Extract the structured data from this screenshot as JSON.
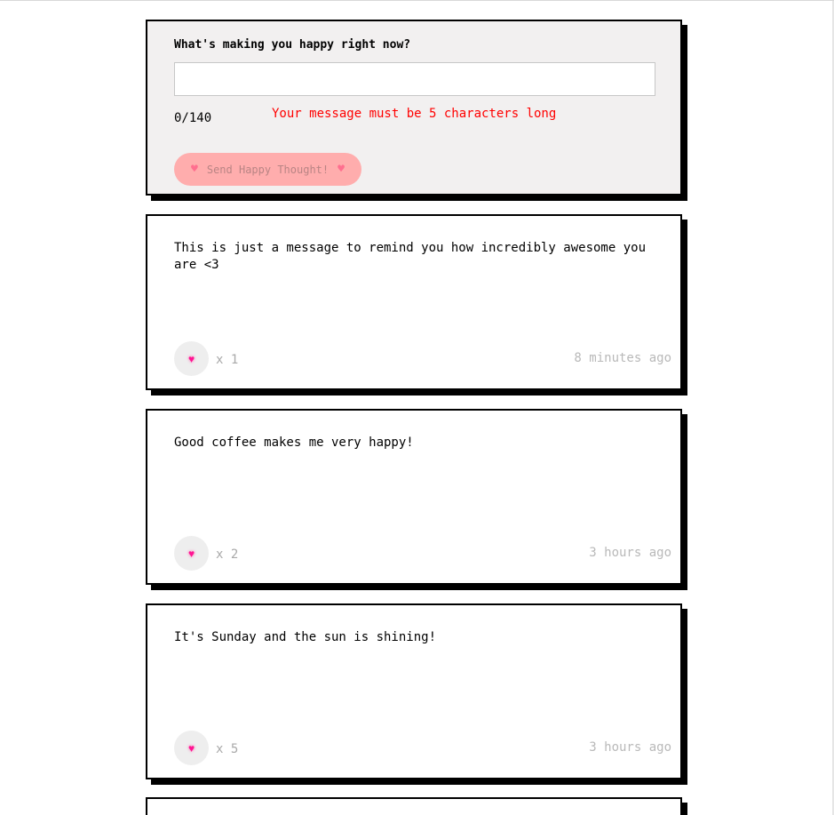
{
  "form": {
    "question": "What's making you happy right now?",
    "input_value": "",
    "input_placeholder": "",
    "char_count": "0/140",
    "error": "Your message must be 5 characters long",
    "send_label": "Send Happy Thought!",
    "send_icon": "heart-emoji"
  },
  "thoughts": [
    {
      "message": "This is just a message to remind you how incredibly awesome you are <3",
      "likes": "x 1",
      "time": "8 minutes ago"
    },
    {
      "message": "Good coffee makes me very happy!",
      "likes": "x 2",
      "time": "3 hours ago"
    },
    {
      "message": "It's Sunday and the sun is shining!",
      "likes": "x 5",
      "time": "3 hours ago"
    }
  ],
  "colors": {
    "error": "#ff0000",
    "send_button_bg": "#ffadad",
    "form_bg": "#f2f0f0",
    "like_button_bg": "#eeeeee",
    "border": "#000000"
  }
}
